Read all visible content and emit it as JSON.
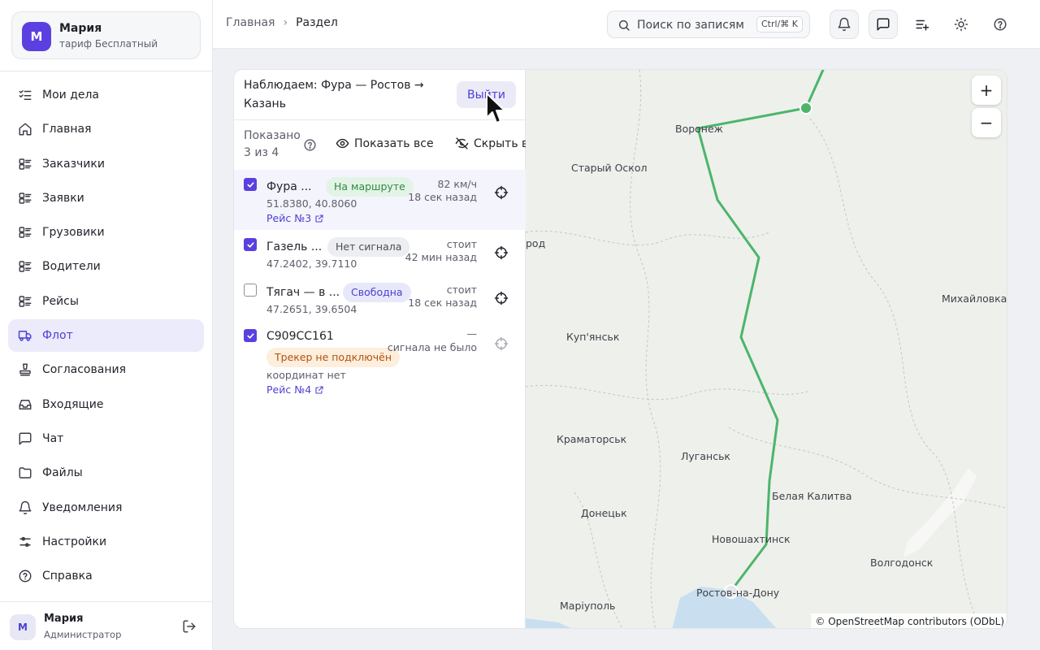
{
  "account": {
    "avatar_letter": "М",
    "name": "Мария",
    "plan": "тариф Бесплатный"
  },
  "nav": [
    {
      "label": "Мои дела",
      "icon": "checklist-icon"
    },
    {
      "label": "Главная",
      "icon": "home-icon"
    },
    {
      "label": "Заказчики",
      "icon": "list-icon"
    },
    {
      "label": "Заявки",
      "icon": "list-icon"
    },
    {
      "label": "Грузовики",
      "icon": "list-icon"
    },
    {
      "label": "Водители",
      "icon": "list-icon"
    },
    {
      "label": "Рейсы",
      "icon": "list-icon"
    },
    {
      "label": "Флот",
      "icon": "truck-icon",
      "active": true
    },
    {
      "label": "Согласования",
      "icon": "stamp-icon"
    },
    {
      "label": "Входящие",
      "icon": "inbox-icon"
    },
    {
      "label": "Чат",
      "icon": "chat-icon"
    },
    {
      "label": "Файлы",
      "icon": "folder-icon"
    },
    {
      "label": "Уведомления",
      "icon": "bell-icon"
    },
    {
      "label": "Настройки",
      "icon": "sliders-icon"
    },
    {
      "label": "Справка",
      "icon": "help-icon"
    }
  ],
  "user": {
    "avatar_letter": "М",
    "name": "Мария",
    "role": "Администратор"
  },
  "breadcrumb": {
    "home": "Главная",
    "current": "Раздел"
  },
  "search": {
    "placeholder": "Поиск по записям",
    "shortcut": "Ctrl/⌘ K"
  },
  "watch": {
    "title": "Наблюдаем: Фура — Ростов → Казань",
    "exit_label": "Выйти"
  },
  "summary": {
    "shown_label": "Показано 3 из 4",
    "show_all": "Показать все",
    "hide_all": "Скрыть все"
  },
  "vehicles": [
    {
      "name": "Фура ...",
      "status": "На маршруте",
      "status_color": "green",
      "coords": "51.8380, 40.8060",
      "trip": "Рейс №3",
      "speed": "82 км/ч",
      "time": "18 сек назад",
      "checked": true
    },
    {
      "name": "Газель ...",
      "status": "Нет сигнала",
      "status_color": "gray",
      "coords": "47.2402, 39.7110",
      "trip": "",
      "speed": "стоит",
      "time": "42 мин назад",
      "checked": true
    },
    {
      "name": "Тягач — в ...",
      "status": "Свободна",
      "status_color": "blue",
      "coords": "47.2651, 39.6504",
      "trip": "",
      "speed": "стоит",
      "time": "18 сек назад",
      "checked": false
    },
    {
      "name": "С909СС161",
      "status": "Трекер не подключён",
      "status_color": "orange",
      "coords": "координат нет",
      "trip": "Рейс №4",
      "speed": "—",
      "time": "сигнала не было",
      "checked": true
    }
  ],
  "map": {
    "cities": [
      "Воронеж",
      "Старый Оскол",
      "род",
      "Михайловка",
      "Куп'янськ",
      "Краматорськ",
      "Луганськ",
      "Белая Калитва",
      "Донецьк",
      "Новошахтинск",
      "Волгодонск",
      "Ростов-на-Дону",
      "Маріуполь"
    ],
    "zoom_in": "+",
    "zoom_out": "−",
    "attribution": "© OpenStreetMap contributors (ODbL)",
    "route_color": "#4cb56a"
  }
}
